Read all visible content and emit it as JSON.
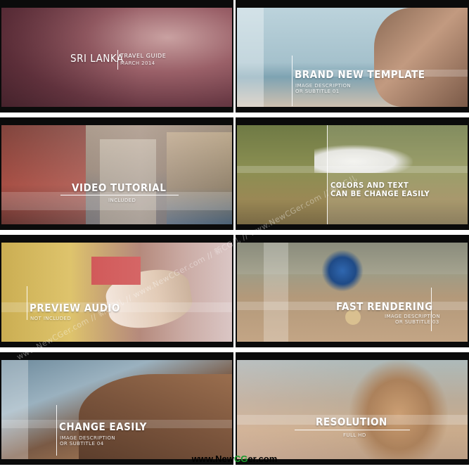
{
  "tiles": [
    {
      "title_main": "SRI LANKA",
      "title_side": "TRAVEL GUIDE",
      "sub_side": "MARCH 2014"
    },
    {
      "title": "BRAND NEW TEMPLATE",
      "sub1": "IMAGE DESCRIPTION",
      "sub2": "OR SUBTITLE 01"
    },
    {
      "title": "VIDEO TUTORIAL",
      "sub1": "INCLUDED"
    },
    {
      "title_line1": "COLORS AND TEXT",
      "title_line2": "CAN BE CHANGE EASILY"
    },
    {
      "title": "PREVIEW AUDIO",
      "sub1": "NOT INCLUDED"
    },
    {
      "title": "FAST RENDERING",
      "sub1": "IMAGE DESCRIPTION",
      "sub2": "OR SUBTITLE 03"
    },
    {
      "title": "CHANGE EASILY",
      "sub1": "IMAGE DESCRIPTION",
      "sub2": "OR SUBTITLE 04"
    },
    {
      "title": "RESOLUTION",
      "sub1": "FULL HD"
    }
  ],
  "watermark": "www.NewCGer.com // 新CG儿 // www.NewCGer.com // 新CG儿 // www.NewCGer.com // 新CG儿",
  "footer": {
    "pre": "www.New",
    "accent": "CG",
    "post": "er.com"
  },
  "colors": {
    "accent": "#1a9a2d",
    "frame": "#0b0b0b"
  }
}
